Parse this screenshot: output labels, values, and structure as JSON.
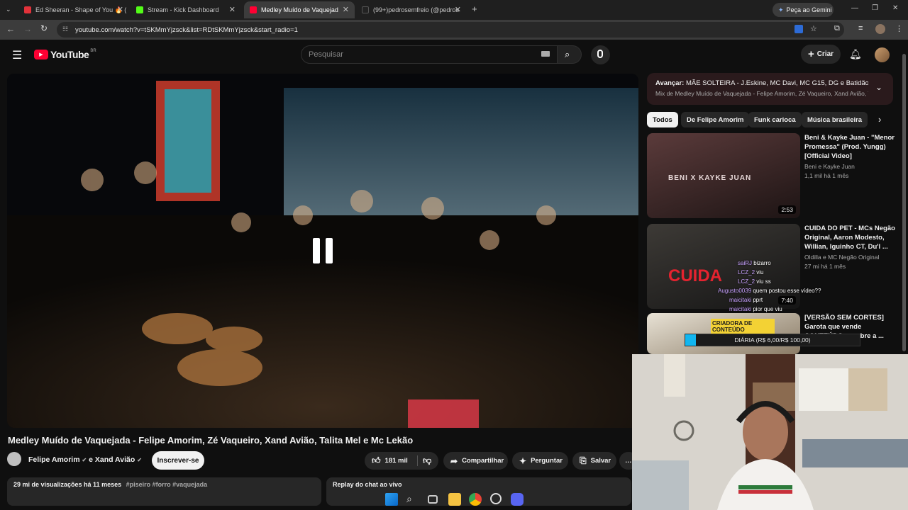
{
  "browser": {
    "tabs": [
      {
        "title": "Ed Sheeran - Shape of You 🔥 (",
        "color": "#e2323a"
      },
      {
        "title": "Stream - Kick Dashboard",
        "color": "#53fc18"
      },
      {
        "title": "Medley Muído de Vaquejad",
        "color": "#ff0033"
      },
      {
        "title": "(99+)pedrosemfreio (@pedros",
        "color": "#222222"
      }
    ],
    "new_tab": "+",
    "gemini_button": "Peça ao Gemini",
    "url": "youtube.com/watch?v=tSKMmYjzsck&list=RDtSKMmYjzsck&start_radio=1"
  },
  "youtube": {
    "logo_text": "YouTube",
    "country": "BR",
    "search_placeholder": "Pesquisar",
    "create_label": "Criar",
    "video": {
      "title": "Medley Muído de Vaquejada - Felipe Amorim, Zé Vaqueiro, Xand Avião, Talita Mel e Mc Lekão",
      "channel": "Felipe Amorim",
      "channel_and": "e Xand Avião",
      "subscribe": "Inscrever-se",
      "likes": "181 mil",
      "share": "Compartilhar",
      "ask": "Perguntar",
      "save": "Salvar",
      "views": "29 mi de visualizações  há 11 meses",
      "tags": "#piseiro #forro #vaquejada",
      "chat_replay": "Replay do chat ao vivo"
    },
    "playlist": {
      "next_label": "Avançar:",
      "next_title": "MÃE SOLTEIRA - J.Eskine, MC Davi, MC G15, DG e Batidão St...",
      "mix": "Mix de Medley Muído de Vaquejada - Felipe Amorim, Zé Vaqueiro, Xand Avião, Talit..."
    },
    "chips": [
      "Todos",
      "De Felipe Amorim",
      "Funk carioca",
      "Música brasileira"
    ],
    "recommendations": [
      {
        "title": "Beni & Kayke Juan - \"Menor Promessa\" (Prod. Yungg) [Official Video]",
        "channel": "Beni    e Kayke Juan",
        "meta": "1,1 mil  há 1 mês",
        "duration": "2:53",
        "thumb_text": "BENI X KAYKE JUAN"
      },
      {
        "title": "CUIDA DO PET - MCs Negão Original, Aaron Modesto, Willian, Iguinho CT, Du'l ...",
        "channel": "Oldilla   e MC Negão Original",
        "meta": "27 mi  há 1 mês",
        "duration": "7:40",
        "thumb_text": "CUIDA"
      },
      {
        "title": "[VERSÃO SEM CORTES] Garota que vende CONTEÚDO ... sobre a ...",
        "channel": "",
        "meta": "",
        "duration": "",
        "thumb_text": "CRIADORA DE CONTEÚDO"
      }
    ]
  },
  "stream_overlay": {
    "chat": [
      {
        "user": "saiRJ",
        "msg": "bizarro"
      },
      {
        "user": "LCZ_2",
        "msg": "viu"
      },
      {
        "user": "LCZ_2",
        "msg": "viu ss"
      },
      {
        "user": "Augusto0039",
        "msg": "quem postou esse vídeo??"
      },
      {
        "user": "maicitaki",
        "msg": "pprt"
      },
      {
        "user": "maicitaki",
        "msg": "pior que viu"
      }
    ],
    "goal_label": "DIÁRIA (R$ 6,00/R$ 100,00)",
    "goal_progress": 0.06
  },
  "colors": {
    "yt_red": "#ff0033",
    "accent_playlist": "#2a1a1c"
  }
}
